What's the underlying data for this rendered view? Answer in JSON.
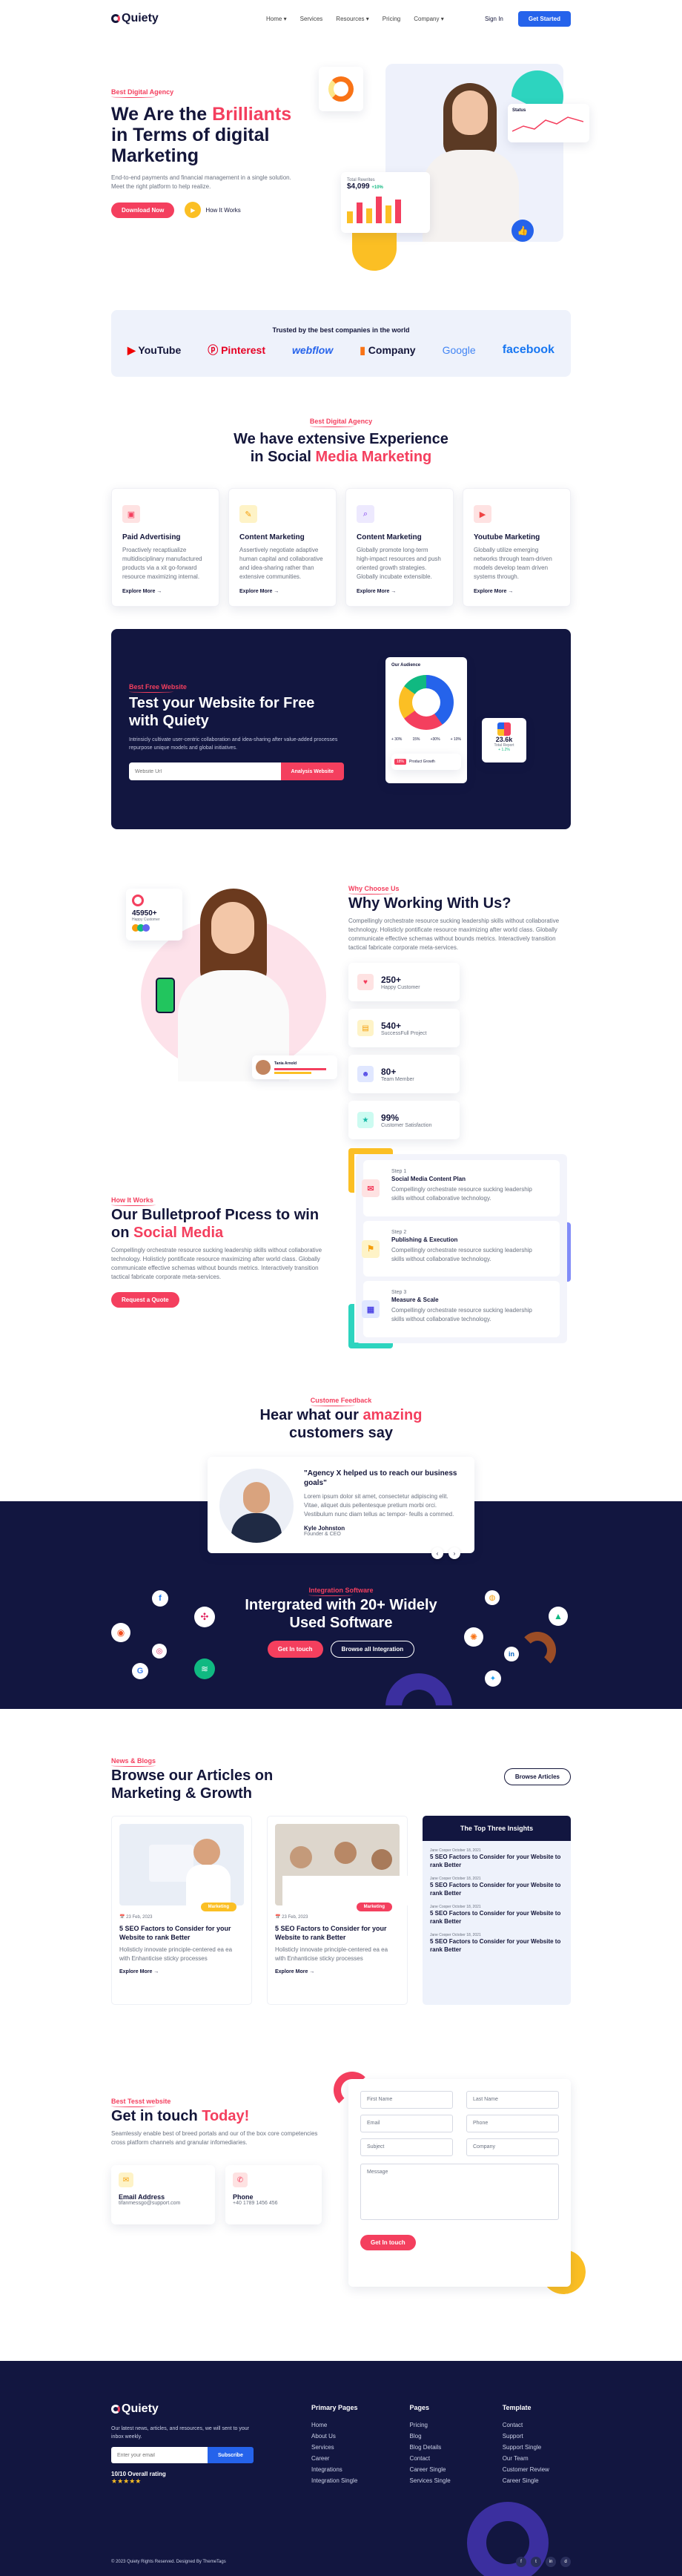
{
  "nav": {
    "logo": "Quiety",
    "links": [
      "Home",
      "Services",
      "Resources",
      "Pricing",
      "Company"
    ],
    "signin": "Sign In",
    "cta": "Get Started"
  },
  "hero": {
    "tag": "Best Digital Agency",
    "h1a": "We Are the ",
    "h1b": "Brilliants",
    "h1c": "in Terms of digital Marketing",
    "desc": "End-to-end payments and financial management in a single solution. Meet the right platform to help realize.",
    "btn": "Download Now",
    "how": "How It Works",
    "total_label": "Total Rewrites",
    "total_value": "$4,099",
    "total_delta": "+10%",
    "status_label": "Status"
  },
  "trusted": {
    "title": "Trusted by the best companies in the world",
    "brands": [
      "YouTube",
      "Pinterest",
      "webflow",
      "Company",
      "Google",
      "facebook"
    ]
  },
  "experience": {
    "tag": "Best Digital Agency",
    "t1": "We have extensive Experience",
    "t2a": "in Social ",
    "t2b": "Media Marketing",
    "cards": [
      {
        "title": "Paid Advertising",
        "text": "Proactively recaptiualize multidisciplinary manufactured products via a xit go-forward resource maximizing internal.",
        "more": "Explore More"
      },
      {
        "title": "Content Marketing",
        "text": "Assertively negotiate adaptive human capital and collaborative and idea-sharing rather than extensive communities.",
        "more": "Explore More"
      },
      {
        "title": "Content Marketing",
        "text": "Globally promote long-term high-impact resources and push oriented growth strategies. Globally incubate extensible.",
        "more": "Explore More"
      },
      {
        "title": "Youtube Marketing",
        "text": "Globally utilize emerging networks through team-driven models develop team driven systems through.",
        "more": "Explore More"
      }
    ]
  },
  "testsite": {
    "tag": "Best Free Website",
    "title": "Test your Website for Free with Quiety",
    "desc": "Intrinsicly cultivate user-centric collaboration and idea-sharing after value-added processes repurpose unique models and global initiatives.",
    "placeholder": "Website Url",
    "btn": "Analysis Website",
    "aud": "Our Audience",
    "p1": "+ 30%",
    "p2": "15%",
    "p3": "+30%",
    "p4": "+ 10%",
    "followers": "23.6k",
    "flabel": "Total Report",
    "slabel": "+ 1.2%",
    "green": "18%",
    "prod": "Product Growth"
  },
  "why": {
    "tag": "Why Choose Us",
    "title": "Why Working With Us?",
    "desc": "Compellingly orchestrate resource sucking leadership skills without collaborative technology. Holisticly pontificate resource maximizing after world class. Globally communicate effective schemas without bounds metrics. Interactively transition tactical fabricate corporate meta-services.",
    "badge_num": "45950+",
    "badge_sub": "Happy Customer",
    "name_tag": "Tania Arnold",
    "stats": [
      {
        "n": "250+",
        "s": "Happy Customer"
      },
      {
        "n": "540+",
        "s": "SuccessFull Project"
      },
      {
        "n": "80+",
        "s": "Team Member"
      },
      {
        "n": "99%",
        "s": "Customer Satisfaction"
      }
    ]
  },
  "process": {
    "tag": "How It Works",
    "t1": "Our Bulletproof Pıcess to win",
    "t2a": "on ",
    "t2b": "Social Media",
    "desc": "Compellingly orchestrate resource sucking leadership skills without collaborative technology. Holisticly pontificate resource maximizing after world class. Globally communicate effective schemas without bounds metrics. Interactively transition tactical fabricate corporate meta-services.",
    "btn": "Request a Quote",
    "steps": [
      {
        "n": "Step 1",
        "t": "Social Media Content Plan",
        "d": "Compellingly orchestrate resource sucking leadership skills without collaborative technology."
      },
      {
        "n": "Step 2",
        "t": "Publishing & Execution",
        "d": "Compellingly orchestrate resource sucking leadership skills without collaborative technology."
      },
      {
        "n": "Step 3",
        "t": "Measure & Scale",
        "d": "Compellingly orchestrate resource sucking leadership skills without collaborative technology."
      }
    ]
  },
  "testimonial": {
    "tag": "Custome Feedback",
    "t1a": "Hear what our ",
    "t1b": "amazing",
    "t2": "customers say",
    "quote": "\"Agency X helped us to reach our business goals\"",
    "text": "Lorem ipsum dolor sit amet, consectetur adipiscing elit. Vitae, aliquet duis pellentesque pretium morbi orci. Vestibulum nunc diam tellus ac tempor- feulls a commed.",
    "name": "Kyle Johnston",
    "role": "Founder & CEO"
  },
  "integration": {
    "tag": "Integration Software",
    "t1": "Intergrated with 20+ Widely",
    "t2": "Used Software",
    "btn1": "Get In touch",
    "btn2": "Browse all Integration"
  },
  "blog": {
    "tag": "News & Blogs",
    "t1": "Browse our Articles on",
    "t2": "Marketing & Growth",
    "browse": "Browse Articles",
    "articles": [
      {
        "cat": "Marketing",
        "date": "23 Feb, 2023",
        "title": "5 SEO Factors to Consider for your Website to rank Better",
        "text": "Holisticly innovate principle-centered ea ea with Enhanticise sticky processes",
        "more": "Explore More"
      },
      {
        "cat": "Marketing",
        "date": "23 Feb, 2023",
        "title": "5 SEO Factors to Consider for your Website to rank Better",
        "text": "Holisticly innovate principle-centered ea ea with Enhanticise sticky processes",
        "more": "Explore More"
      }
    ],
    "top_title": "The Top Three Insights",
    "top": [
      {
        "date": "Jane Cooper October 18, 2021",
        "t": "5 SEO Factors to Consider for your Website to rank Better"
      },
      {
        "date": "Jane Cooper October 18, 2021",
        "t": "5 SEO Factors to Consider for your Website to rank Better"
      },
      {
        "date": "Jane Cooper October 18, 2021",
        "t": "5 SEO Factors to Consider for your Website to rank Better"
      },
      {
        "date": "Jane Cooper October 18, 2021",
        "t": "5 SEO Factors to Consider for your Website to rank Better"
      }
    ]
  },
  "contact": {
    "tag": "Best Tesst website",
    "t1": "Get in touch ",
    "t1b": "Today!",
    "desc": "Seamlessly enable best of breed portals and our of the box core competencies cross platform channels and granular infomediaries.",
    "email_label": "Email Address",
    "email": "tifanmessgo@support.com",
    "phone_label": "Phone",
    "phone": "+40 1789 1456 456",
    "fields": [
      "First Name",
      "Last Name",
      "Email",
      "Phone",
      "Subject",
      "Company"
    ],
    "msg": "Message",
    "btn": "Get In touch"
  },
  "footer": {
    "logo": "Quiety",
    "desc": "Our latest news, articles, and resources, we will sent to your inbox weekly.",
    "placeholder": "Enter your email",
    "btn": "Subscribe",
    "rating": "10/10 Overall rating",
    "stars": "★★★★★",
    "cols": [
      {
        "h": "Primary Pages",
        "items": [
          "Home",
          "About Us",
          "Services",
          "Career",
          "Integrations",
          "Integration Single"
        ]
      },
      {
        "h": "Pages",
        "items": [
          "Pricing",
          "Blog",
          "Blog Details",
          "Contact",
          "Career Single",
          "Services Single"
        ]
      },
      {
        "h": "Template",
        "items": [
          "Contact",
          "Support",
          "Support Single",
          "Our Team",
          "Customer Review",
          "Career Single"
        ]
      }
    ],
    "copy": "© 2023 Quiety Rights Reserved. Designed By ThemeTags",
    "social": [
      "f",
      "t",
      "in",
      "d"
    ]
  }
}
